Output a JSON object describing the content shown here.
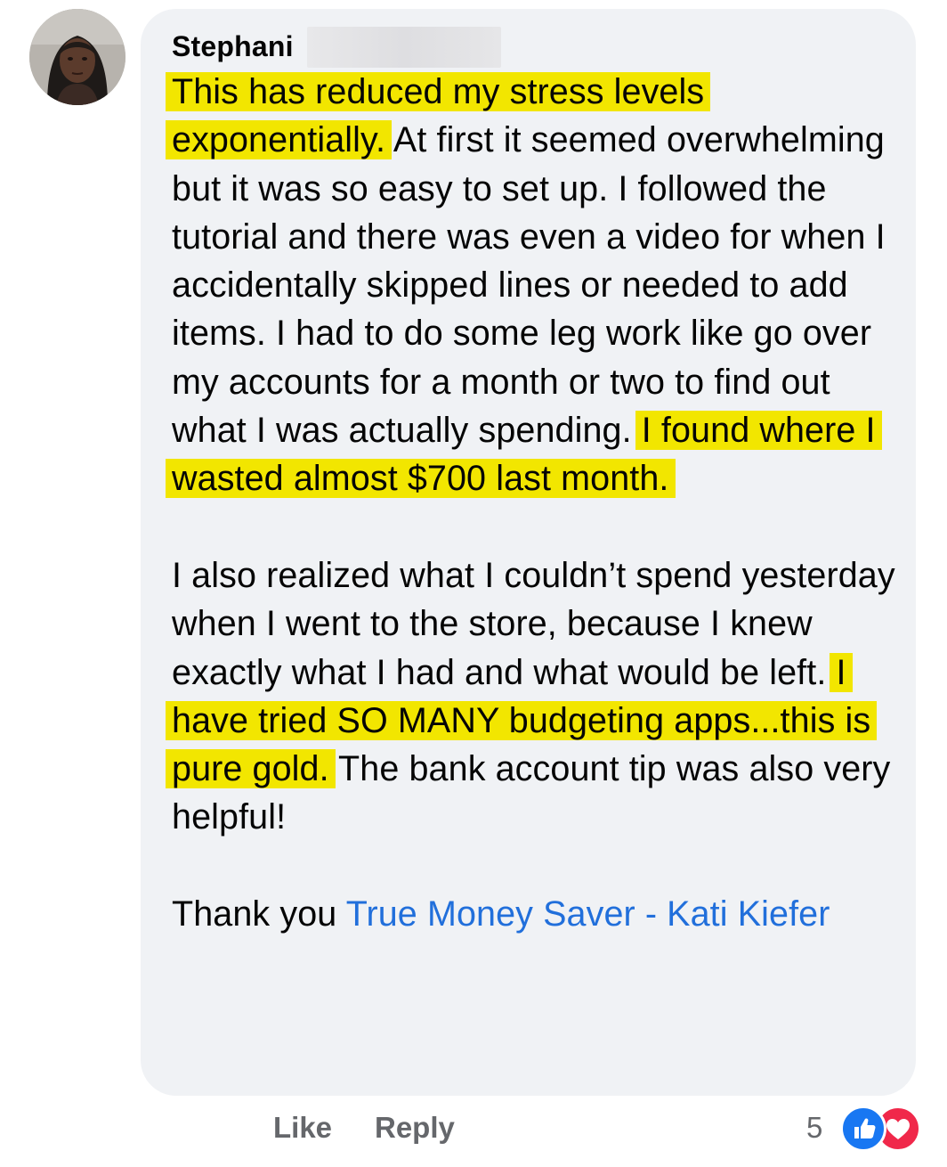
{
  "comment": {
    "author": "Stephani",
    "paragraphs": [
      [
        {
          "text": "This has reduced my stress levels exponentially.",
          "highlight": true
        },
        {
          "text": " At first it seemed overwhelming but it was so easy to set up. I followed the tutorial and there was even a video for when I accidentally skipped lines or needed to add items. I had to do some leg work like go over my accounts for a month or two to find out what I was actually spending. ",
          "highlight": false
        },
        {
          "text": "I found where I wasted almost $700 last month.",
          "highlight": true
        }
      ],
      [
        {
          "text": "I also realized what I couldn’t spend yesterday when I went to the store, because I knew exactly what I had and what would be left. ",
          "highlight": false
        },
        {
          "text": "I have tried SO MANY budgeting apps...this is pure gold.",
          "highlight": true
        },
        {
          "text": " The bank account tip was also very helpful!",
          "highlight": false
        }
      ],
      [
        {
          "text": "Thank you ",
          "highlight": false
        },
        {
          "text": "True Money Saver - Kati Kiefer",
          "mention": true
        }
      ]
    ]
  },
  "actions": {
    "like_label": "Like",
    "reply_label": "Reply"
  },
  "reactions": {
    "count": "5",
    "icons": [
      "thumbs-up-icon",
      "heart-icon"
    ]
  },
  "colors": {
    "highlight": "#f2e600",
    "mention": "#216fdb",
    "bubble": "#f0f2f5",
    "secondary_text": "#65676b",
    "like_blue": "#1877f2",
    "love_red": "#f0284a"
  }
}
